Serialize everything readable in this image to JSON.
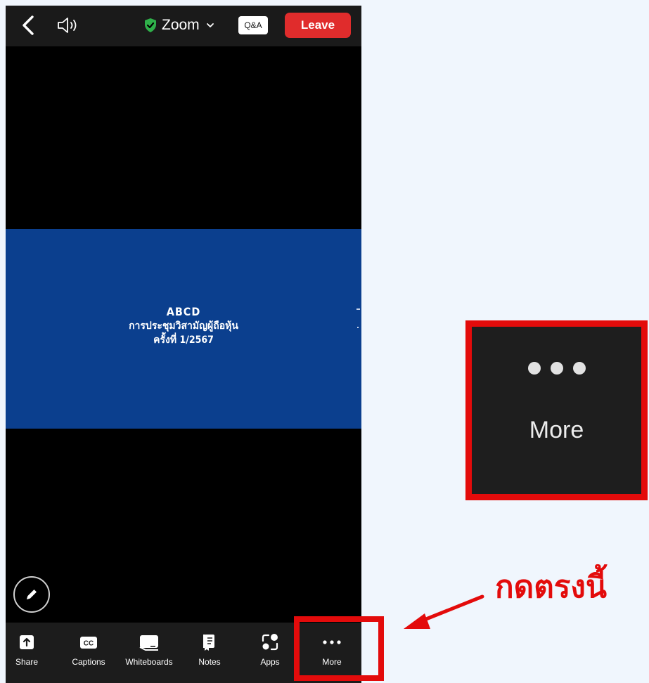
{
  "topbar": {
    "meeting_title": "Zoom",
    "qa_label": "Q&A",
    "leave_label": "Leave"
  },
  "slide": {
    "line1": "ABCD",
    "line2": "การประชุมวิสามัญผู้ถือหุ้น",
    "line3": "ครั้งที่ 1/2567",
    "background": "#0b3f8e"
  },
  "toolbar": {
    "items": [
      {
        "label": "Share",
        "icon": "share-icon"
      },
      {
        "label": "Captions",
        "icon": "captions-icon"
      },
      {
        "label": "Whiteboards",
        "icon": "whiteboard-icon"
      },
      {
        "label": "Notes",
        "icon": "notes-icon"
      },
      {
        "label": "Apps",
        "icon": "apps-icon"
      },
      {
        "label": "More",
        "icon": "more-icon"
      }
    ]
  },
  "callout": {
    "label": "More"
  },
  "instruction": "กดตรงนี้",
  "colors": {
    "highlight": "#e30b0b",
    "leave": "#e02c2c",
    "verified": "#2fb04a"
  }
}
